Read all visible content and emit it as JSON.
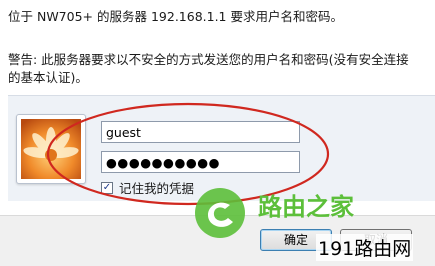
{
  "dialog": {
    "line1": "位于 NW705+ 的服务器 192.168.1.1 要求用户名和密码。",
    "warning_line1": "警告: 此服务器要求以不安全的方式发送您的用户名和密码(没有安全连接",
    "warning_line2": "的基本认证)。"
  },
  "credentials": {
    "username_value": "guest",
    "password_value": "●●●●●●●●●●",
    "remember_label": "记住我的凭据",
    "remember_checked": true,
    "check_mark": "✓"
  },
  "buttons": {
    "ok_label": "确定",
    "cancel_label": "取消"
  },
  "watermarks": {
    "center_text": "路由之家",
    "corner_text": "191路由网",
    "logo_color": "#5cbf3a"
  },
  "colors": {
    "annotation_ellipse": "#d0281f",
    "panel_background": "#eef2f7"
  }
}
